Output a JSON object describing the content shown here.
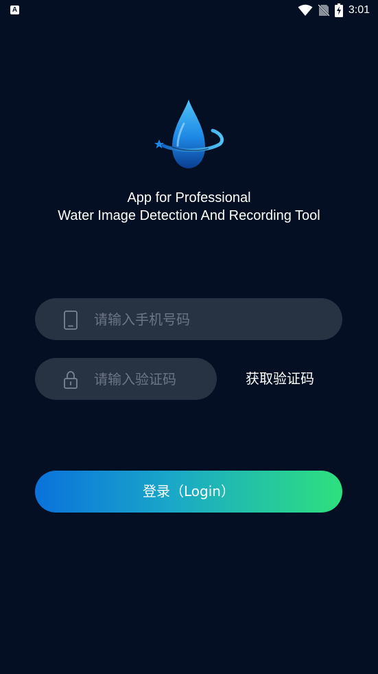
{
  "status_bar": {
    "left_icon": "A",
    "time": "3:01",
    "icons": [
      "wifi-icon",
      "no-sim-icon",
      "battery-charging-icon"
    ]
  },
  "logo": {
    "icon": "water-drop-logo-icon",
    "colors": {
      "drop_top": "#4fc3f7",
      "drop_bottom": "#0a3d91",
      "ring": "#1e88e5"
    }
  },
  "tagline": {
    "line1": "App for Professional",
    "line2": "Water Image Detection And Recording Tool"
  },
  "form": {
    "phone": {
      "icon": "phone-icon",
      "value": "",
      "placeholder": "请输入手机号码"
    },
    "code": {
      "icon": "lock-icon",
      "value": "",
      "placeholder": "请输入验证码"
    },
    "get_code_label": "获取验证码",
    "login_label": "登录（Login）"
  },
  "colors": {
    "background": "#050f23",
    "field_background": "#273243",
    "placeholder": "#6b7585",
    "button_gradient_start": "#0a72dc",
    "button_gradient_end": "#2ee07d"
  }
}
